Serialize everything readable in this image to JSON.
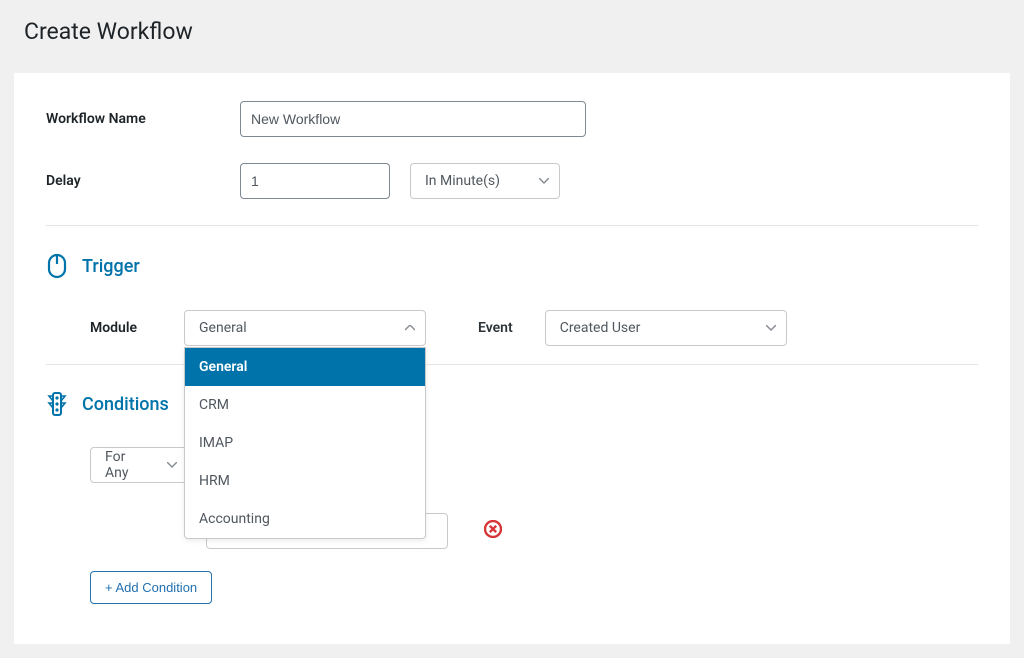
{
  "page": {
    "title": "Create Workflow"
  },
  "form": {
    "workflow_name_label": "Workflow Name",
    "workflow_name_value": "New Workflow",
    "delay_label": "Delay",
    "delay_value": "1",
    "delay_unit_selected": "In Minute(s)"
  },
  "trigger": {
    "section_title": "Trigger",
    "module_label": "Module",
    "module_selected": "General",
    "module_options": [
      "General",
      "CRM",
      "IMAP",
      "HRM",
      "Accounting"
    ],
    "event_label": "Event",
    "event_selected": "Created User"
  },
  "conditions": {
    "section_title": "Conditions",
    "forany_label": "For Any",
    "add_condition_label": "+ Add Condition"
  }
}
